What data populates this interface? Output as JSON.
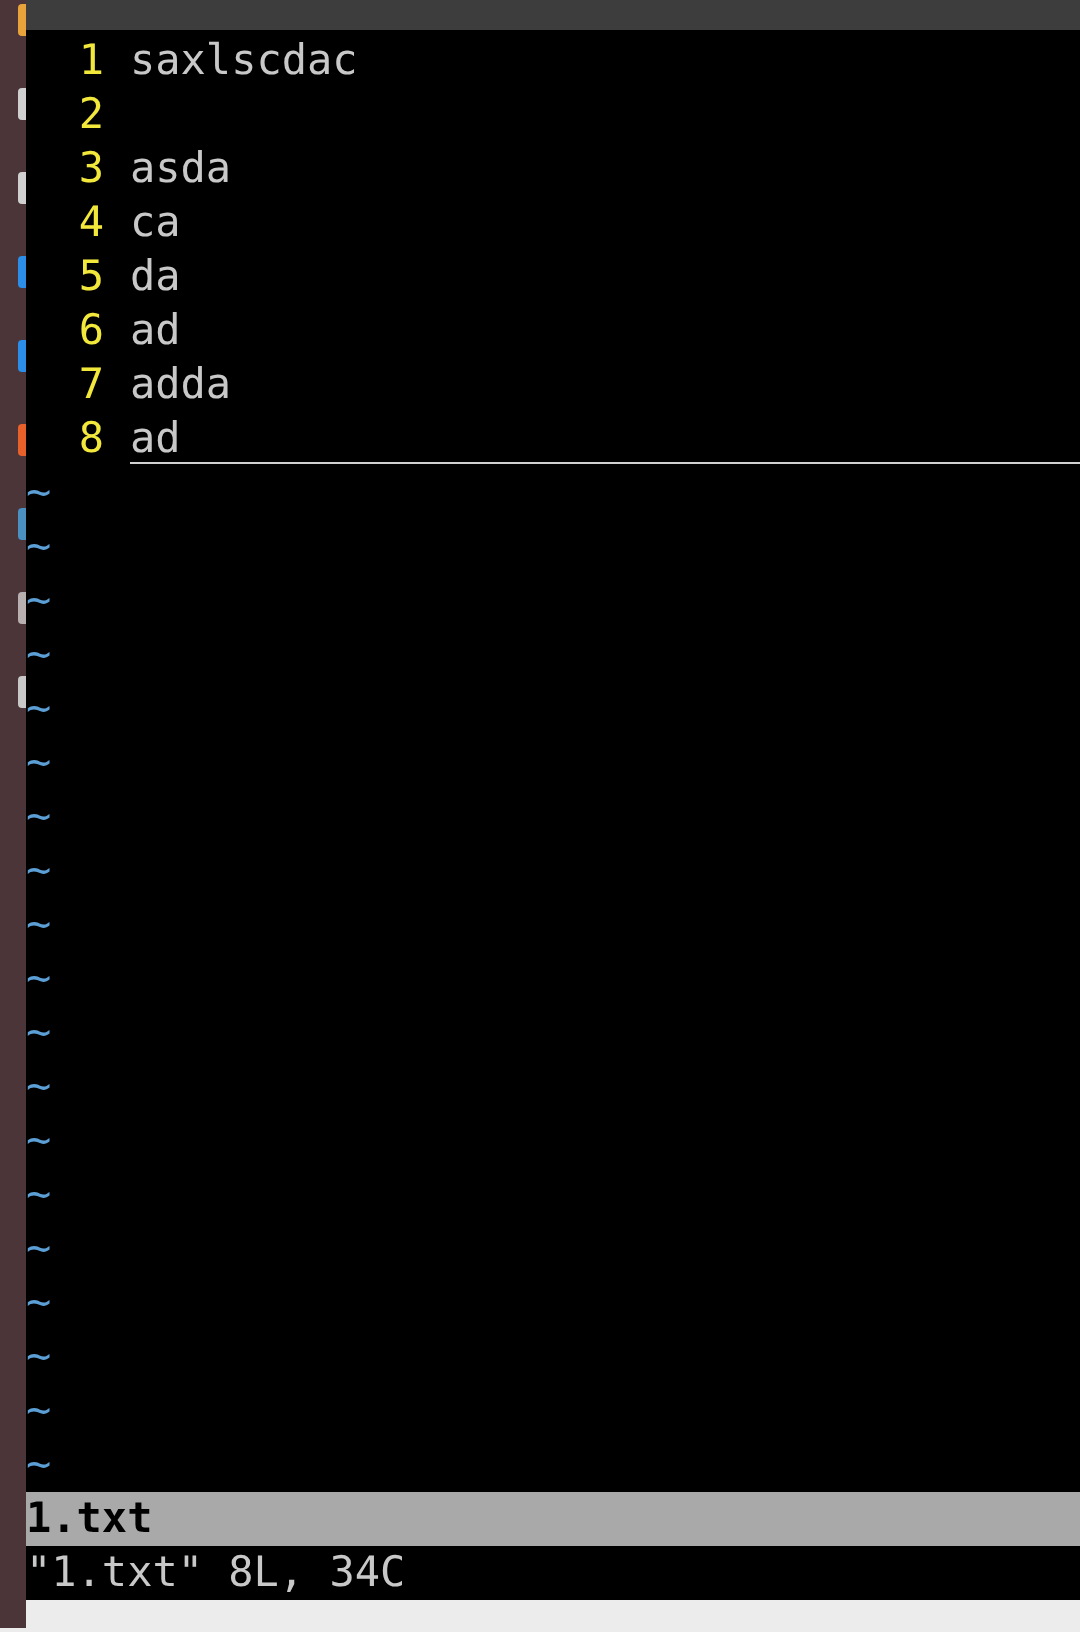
{
  "editor": {
    "lines": [
      {
        "number": "1",
        "text": "saxlscdac",
        "cursor": false
      },
      {
        "number": "2",
        "cursor": false
      },
      {
        "number": "3",
        "text": "asda",
        "cursor": false
      },
      {
        "number": "4",
        "text": "ca",
        "cursor": false
      },
      {
        "number": "5",
        "text": "da",
        "cursor": false
      },
      {
        "number": "6",
        "text": "ad",
        "cursor": false
      },
      {
        "number": "7",
        "text": "adda",
        "cursor": false
      },
      {
        "number": "8",
        "text": "ad",
        "cursor": true
      }
    ],
    "empty_lines": [
      "~",
      "~",
      "~",
      "~",
      "~",
      "~",
      "~",
      "~",
      "~",
      "~",
      "~",
      "~",
      "~",
      "~",
      "~",
      "~",
      "~",
      "~",
      "~"
    ]
  },
  "status_line": {
    "filename": "1.txt"
  },
  "message": "\"1.txt\" 8L, 34C"
}
